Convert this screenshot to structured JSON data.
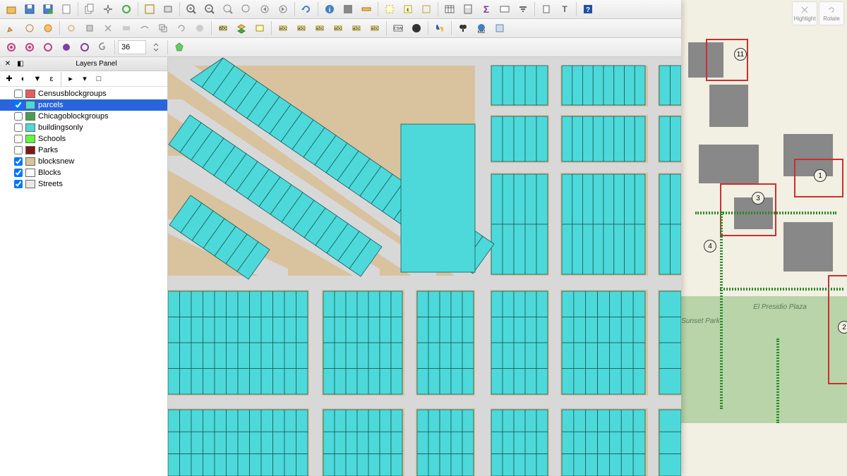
{
  "panel": {
    "title": "Layers Panel"
  },
  "layers": [
    {
      "name": "Censusblockgroups",
      "checked": false,
      "color": "#e85c5c",
      "selected": false
    },
    {
      "name": "parcels",
      "checked": true,
      "color": "#4dd9d9",
      "selected": true
    },
    {
      "name": "Chicagoblockgroups",
      "checked": false,
      "color": "#4a9e4a",
      "selected": false
    },
    {
      "name": "buildingsonly",
      "checked": false,
      "color": "#4dd9d9",
      "selected": false
    },
    {
      "name": "Schools",
      "checked": false,
      "color": "#5cff3c",
      "selected": false
    },
    {
      "name": "Parks",
      "checked": false,
      "color": "#7a1818",
      "selected": false
    },
    {
      "name": "blocksnew",
      "checked": true,
      "color": "#d9c29e",
      "selected": false
    },
    {
      "name": "Blocks",
      "checked": true,
      "color": "#ffffff",
      "selected": false
    },
    {
      "name": "Streets",
      "checked": true,
      "color": "#e8e8e8",
      "selected": false
    }
  ],
  "vertex_count": "36",
  "right_tools": {
    "highlight": "Highlight",
    "rotate": "Rotate"
  },
  "ref_map": {
    "labels": {
      "sunset_park": "Sunset Park",
      "el_presidio": "El Presidio Plaza"
    },
    "markers": [
      "1",
      "2",
      "3",
      "4",
      "11"
    ]
  },
  "icons": {
    "toolbar1": [
      "open-icon",
      "save-icon",
      "save-as-icon",
      "new-icon",
      "copy-icon",
      "pan-icon",
      "refresh-icon",
      "extent-icon",
      "new-print-icon",
      "zoom-in-icon",
      "zoom-out-icon",
      "zoom-full-icon",
      "zoom-layer-icon",
      "zoom-last-icon",
      "zoom-next-icon",
      "refresh2-icon",
      "info-icon",
      "identify-icon",
      "measure-icon",
      "select-icon",
      "select-rect-icon",
      "deselect-icon",
      "table-icon",
      "calc-icon",
      "sigma-icon",
      "expression-icon",
      "filter-icon",
      "bookmark-icon",
      "text-icon",
      "help-icon"
    ],
    "toolbar2": [
      "edit-icon",
      "node-icon",
      "add-feature-icon",
      "move-icon",
      "vertex-icon",
      "split-icon",
      "merge-icon",
      "reshape-icon",
      "offset-icon",
      "rotate-icon",
      "simplify-icon",
      "label-icon",
      "layer-props-icon",
      "style-icon",
      "label2-icon",
      "annotation-icon",
      "label3-icon",
      "label4-icon",
      "label5-icon",
      "label6-icon",
      "csw-icon",
      "globe-icon",
      "python-icon",
      "search2-icon",
      "kmz-icon",
      "osm-icon"
    ],
    "toolbar3": [
      "shape1-icon",
      "shape2-icon",
      "shape3-icon",
      "circle1-icon",
      "circle2-icon",
      "spiral-icon",
      "polygon-icon"
    ]
  }
}
